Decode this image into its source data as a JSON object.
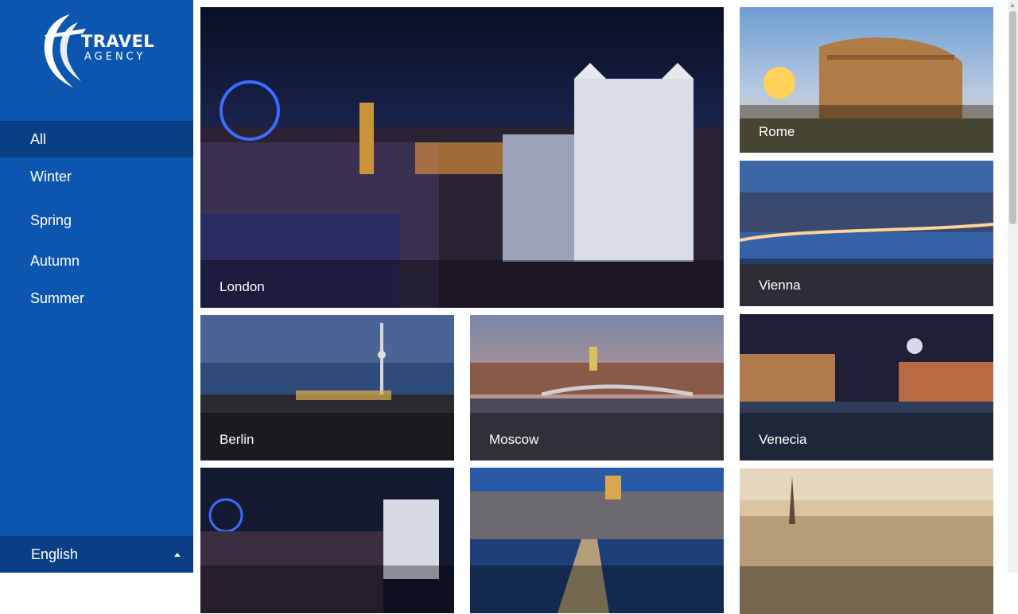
{
  "brand": {
    "line1": "TRAVEL",
    "line2": "AGENCY"
  },
  "nav": [
    {
      "label": "All",
      "active": true
    },
    {
      "label": "Winter",
      "active": false
    },
    {
      "label": "Spring",
      "active": false
    },
    {
      "label": "Autumn",
      "active": false
    },
    {
      "label": "Summer",
      "active": false
    }
  ],
  "language": {
    "label": "English"
  },
  "destinations": [
    {
      "name": "London"
    },
    {
      "name": "Rome"
    },
    {
      "name": "Vienna"
    },
    {
      "name": "Berlin"
    },
    {
      "name": "Moscow"
    },
    {
      "name": "Venecia"
    },
    {
      "name": ""
    },
    {
      "name": ""
    },
    {
      "name": ""
    }
  ],
  "colors": {
    "sidebar": "#0d56b0",
    "sidebar_active": "#0a3f86"
  }
}
